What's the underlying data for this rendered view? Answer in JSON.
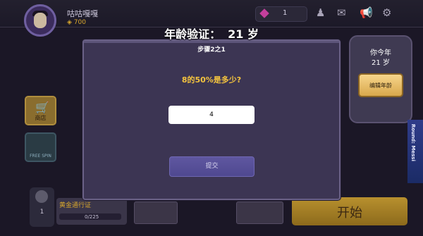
{
  "header": {
    "player_name": "咕咕嘎嘎",
    "coins": "700",
    "gems": "1",
    "icons": [
      "profile-icon",
      "mail-icon",
      "announcement-icon",
      "settings-icon"
    ]
  },
  "left_menu": {
    "shop_label": "商店",
    "free_label": "FREE SPIN"
  },
  "bottom": {
    "level": "1",
    "gold_pass_title": "黄金通行证",
    "gold_pass_progress": "0/225",
    "start_label": "开始"
  },
  "age_panel": {
    "line1": "你今年",
    "line2": "21 岁",
    "edit_button": "编辑年龄"
  },
  "side_banner": {
    "text": "Round: Messi"
  },
  "dialog": {
    "title": "年龄验证：",
    "age": "21 岁",
    "step": "步骤2之1",
    "question": "8的50%是多少?",
    "input_value": "4",
    "submit_label": "提交"
  },
  "colors": {
    "dialog_bg": "#3c3553",
    "question_color": "#f5c43e",
    "submit_bg": "#5f57a0",
    "start_bg": "#b8902e"
  }
}
